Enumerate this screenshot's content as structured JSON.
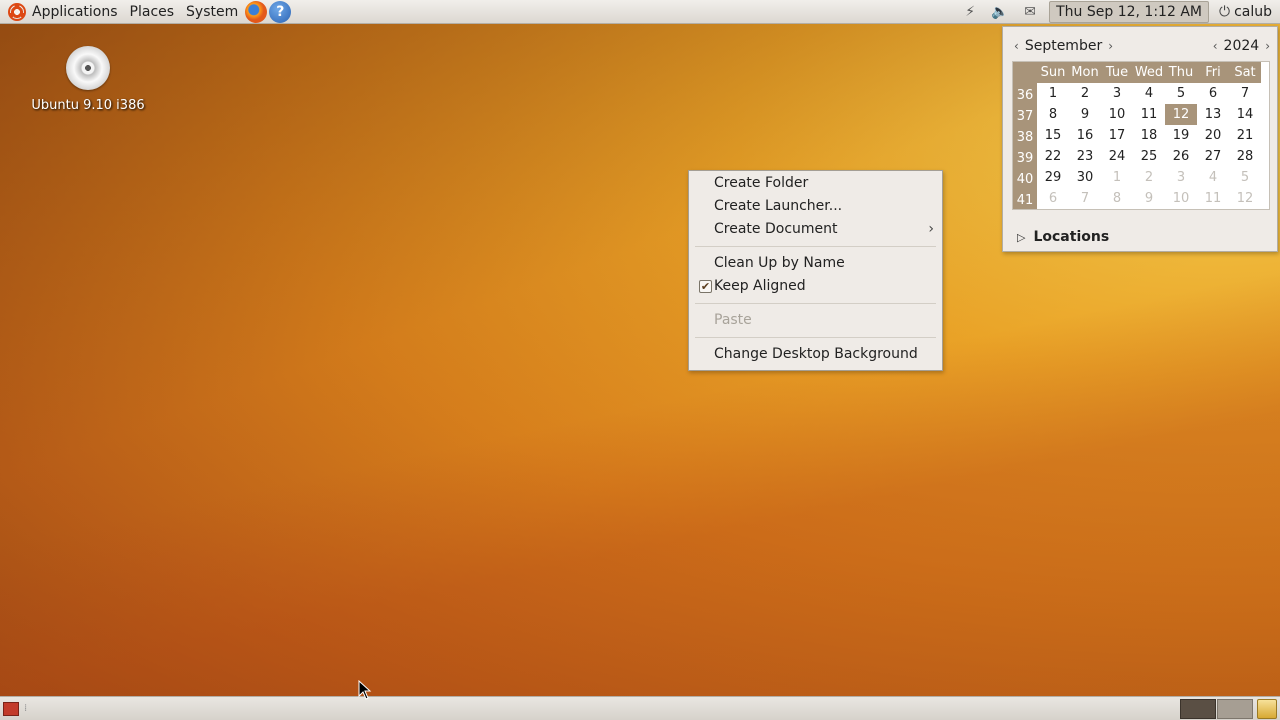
{
  "top_panel": {
    "menus": [
      "Applications",
      "Places",
      "System"
    ],
    "clock": "Thu Sep 12,  1:12 AM",
    "user": "calub"
  },
  "desktop": {
    "icon_label": "Ubuntu 9.10 i386"
  },
  "context_menu": {
    "items": [
      {
        "label": "Create Folder",
        "enabled": true
      },
      {
        "label": "Create Launcher...",
        "enabled": true
      },
      {
        "label": "Create Document",
        "enabled": true,
        "submenu": true
      },
      {
        "label": "Clean Up by Name",
        "enabled": true
      },
      {
        "label": "Keep Aligned",
        "enabled": true,
        "checked": true
      },
      {
        "label": "Paste",
        "enabled": false
      },
      {
        "label": "Change Desktop Background",
        "enabled": true
      }
    ]
  },
  "calendar": {
    "month": "September",
    "year": "2024",
    "day_headers": [
      "Sun",
      "Mon",
      "Tue",
      "Wed",
      "Thu",
      "Fri",
      "Sat"
    ],
    "weeks": [
      {
        "num": "36",
        "days": [
          "1",
          "2",
          "3",
          "4",
          "5",
          "6",
          "7"
        ]
      },
      {
        "num": "37",
        "days": [
          "8",
          "9",
          "10",
          "11",
          "12",
          "13",
          "14"
        ]
      },
      {
        "num": "38",
        "days": [
          "15",
          "16",
          "17",
          "18",
          "19",
          "20",
          "21"
        ]
      },
      {
        "num": "39",
        "days": [
          "22",
          "23",
          "24",
          "25",
          "26",
          "27",
          "28"
        ]
      },
      {
        "num": "40",
        "days": [
          "29",
          "30",
          "1",
          "2",
          "3",
          "4",
          "5"
        ]
      },
      {
        "num": "41",
        "days": [
          "6",
          "7",
          "8",
          "9",
          "10",
          "11",
          "12"
        ]
      }
    ],
    "today": "12",
    "locations_label": "Locations"
  },
  "colors": {
    "accent": "#a8947a",
    "panel": "#dcd8d1",
    "wallpaper": "#e39a2a"
  }
}
